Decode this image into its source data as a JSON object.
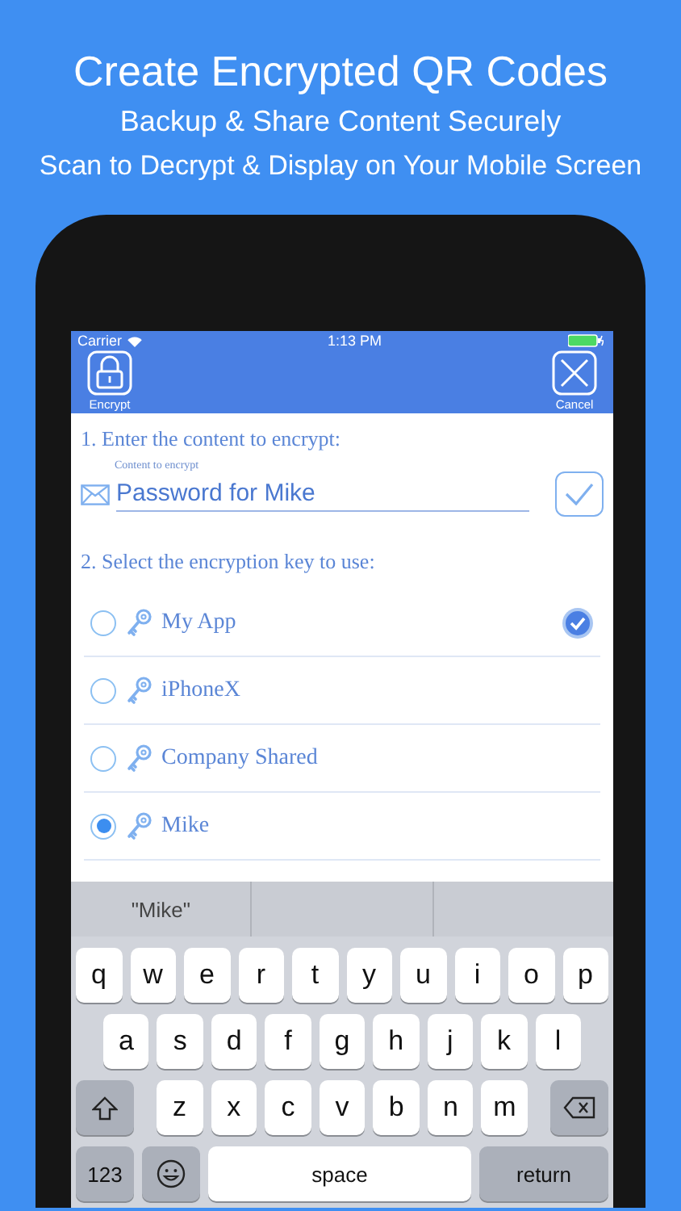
{
  "headline": {
    "title": "Create Encrypted QR Codes",
    "subtitles": [
      "Backup & Share Content Securely",
      "Scan to Decrypt & Display on Your Mobile Screen"
    ]
  },
  "status_bar": {
    "carrier": "Carrier",
    "time": "1:13 PM"
  },
  "nav_bar": {
    "left_button": "Encrypt",
    "right_button": "Cancel"
  },
  "step_1": {
    "label": "1. Enter the content to encrypt:",
    "field": {
      "label": "Content to encrypt",
      "value": "Password for Mike"
    }
  },
  "step_2": {
    "label": "2. Select the encryption key to use:",
    "keys": [
      {
        "name": "My App",
        "selected": false,
        "is_default": true
      },
      {
        "name": "iPhoneX",
        "selected": false,
        "is_default": false
      },
      {
        "name": "Company Shared",
        "selected": false,
        "is_default": false
      },
      {
        "name": "Mike",
        "selected": true,
        "is_default": false
      }
    ]
  },
  "keyboard": {
    "suggestions": [
      "\"Mike\""
    ],
    "rows": [
      [
        "q",
        "w",
        "e",
        "r",
        "t",
        "y",
        "u",
        "i",
        "o",
        "p"
      ],
      [
        "a",
        "s",
        "d",
        "f",
        "g",
        "h",
        "j",
        "k",
        "l"
      ],
      [
        "z",
        "x",
        "c",
        "v",
        "b",
        "n",
        "m"
      ]
    ],
    "numbers_key": "123",
    "space_key": "space",
    "return_key": "return"
  }
}
